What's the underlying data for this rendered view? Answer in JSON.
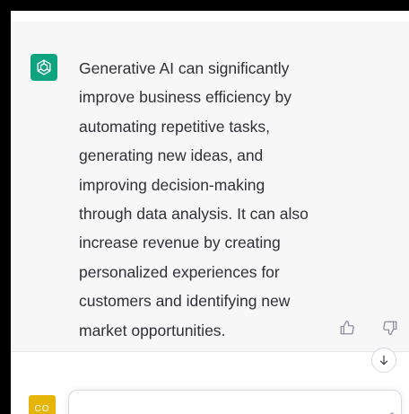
{
  "conversation": {
    "assistant_reply_lines": [
      "Generative AI can significantly",
      "improve business efficiency by",
      "automating repetitive tasks,",
      "generating new ideas, and",
      "improving decision-making",
      "through data analysis. It can also",
      "increase revenue by creating",
      "personalized experiences for",
      "customers and identifying new",
      "market opportunities."
    ],
    "assistant_icon": "openai-logo-icon",
    "feedback_icons": [
      "thumbs-up-icon",
      "thumbs-down-icon"
    ]
  },
  "scroll_button": {
    "icon": "arrow-down-icon"
  },
  "user": {
    "avatar_initials": "CO"
  },
  "composer": {
    "value": "",
    "send_icon": "send-icon"
  },
  "colors": {
    "assistant_accent": "#10a37f",
    "user_avatar": "#e7b40a",
    "answer_background": "#f7f7f8",
    "text": "#2f2f36"
  }
}
